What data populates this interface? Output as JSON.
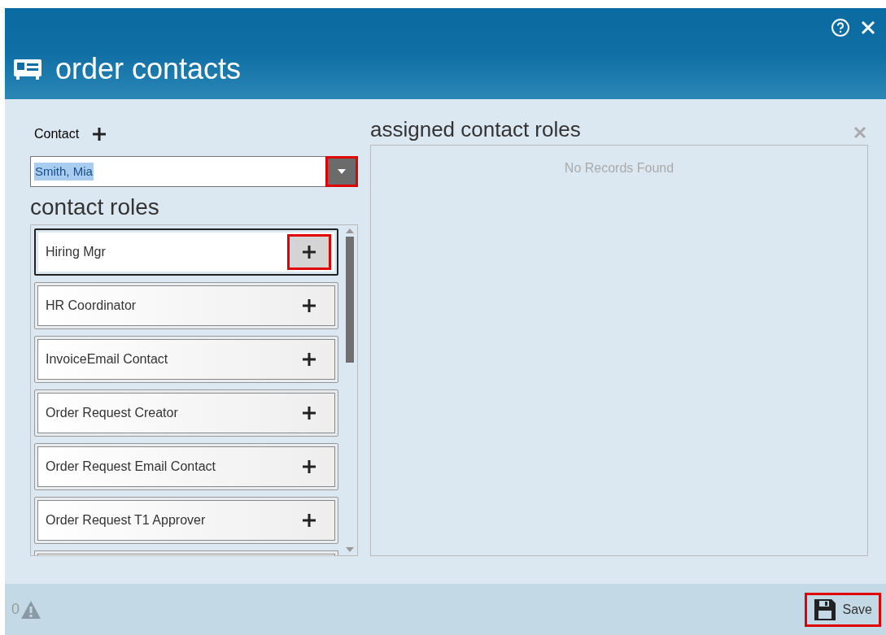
{
  "window": {
    "title": "order contacts"
  },
  "contact": {
    "label": "Contact",
    "value": "Smith, Mia",
    "dropdown_highlighted": true
  },
  "roles": {
    "title": "contact roles",
    "items": [
      {
        "label": "Hiring Mgr",
        "selected": true,
        "highlighted": true
      },
      {
        "label": "HR Coordinator",
        "selected": false,
        "highlighted": false
      },
      {
        "label": "InvoiceEmail Contact",
        "selected": false,
        "highlighted": false
      },
      {
        "label": "Order Request Creator",
        "selected": false,
        "highlighted": false
      },
      {
        "label": "Order Request Email Contact",
        "selected": false,
        "highlighted": false
      },
      {
        "label": "Order Request T1 Approver",
        "selected": false,
        "highlighted": false
      }
    ]
  },
  "assigned": {
    "title": "assigned contact roles",
    "empty_text": "No Records Found"
  },
  "footer": {
    "warning_count": "0",
    "save": {
      "label": "Save",
      "highlighted": true
    }
  }
}
